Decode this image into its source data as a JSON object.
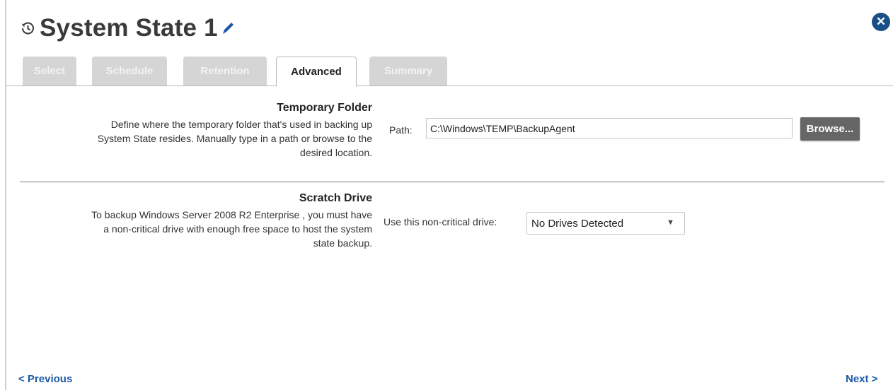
{
  "header": {
    "title": "System State 1",
    "history_icon": "history-icon",
    "edit_icon": "pencil-icon",
    "close_icon": "close-icon"
  },
  "tabs": [
    {
      "label": "Select",
      "active": false
    },
    {
      "label": "Schedule",
      "active": false
    },
    {
      "label": "Retention",
      "active": false
    },
    {
      "label": "Advanced",
      "active": true
    },
    {
      "label": "Summary",
      "active": false
    }
  ],
  "temp_folder": {
    "title": "Temporary Folder",
    "desc_lines": [
      "Define where the temporary folder that's used in backing up",
      "System State resides. Manually type in a path or browse to the",
      "desired location."
    ],
    "path_label": "Path:",
    "path_value": "C:\\Windows\\TEMP\\BackupAgent",
    "browse_label": "Browse..."
  },
  "scratch_drive": {
    "title": "Scratch Drive",
    "desc_lines": [
      "To backup Windows Server 2008 R2 Enterprise , you must have",
      "a non-critical drive with enough free space to host the system",
      "state backup."
    ],
    "drive_label": "Use this non-critical drive:",
    "drive_value": "No Drives Detected"
  },
  "footer": {
    "previous_label": "< Previous",
    "next_label": "Next >"
  },
  "colors": {
    "accent": "#1c5aa6",
    "close_bg": "#1a4f86",
    "inactive_tab": "#d5d5d5",
    "button_bg": "#666666"
  }
}
